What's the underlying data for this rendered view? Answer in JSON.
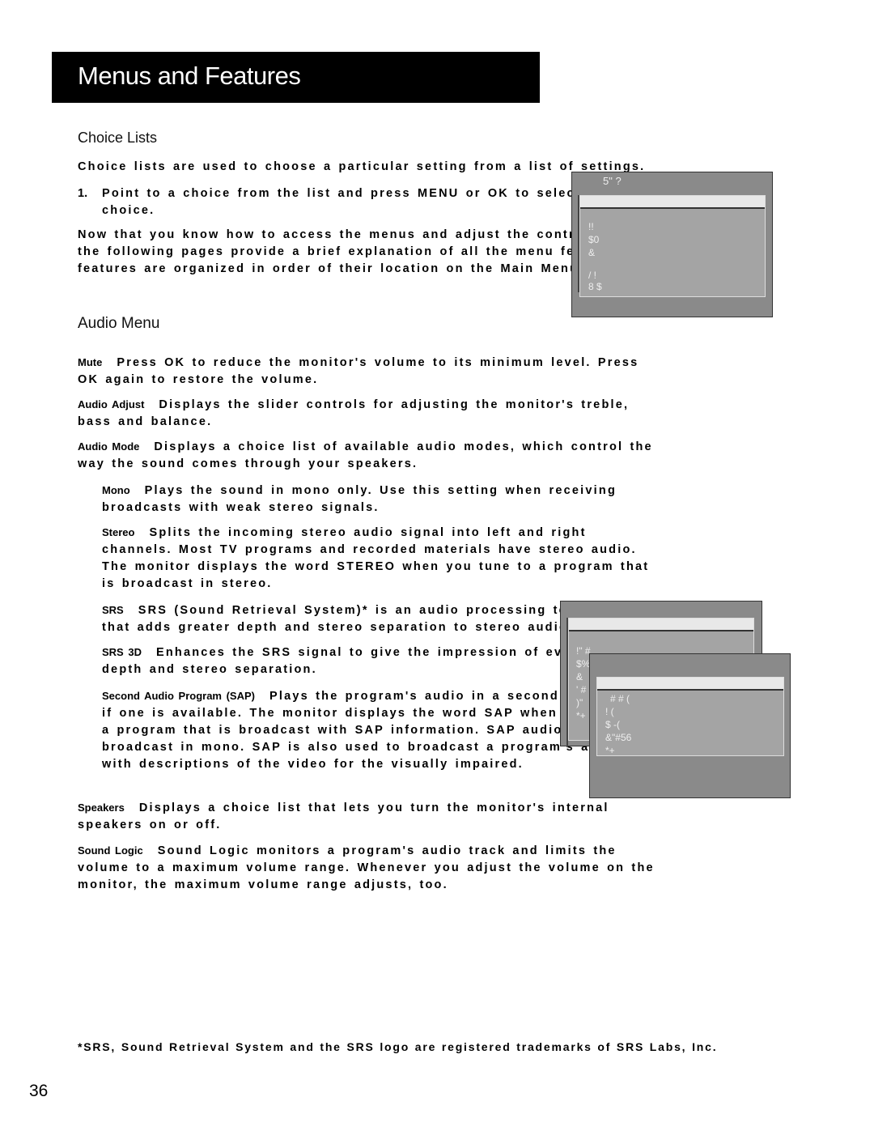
{
  "header": {
    "title": "Menus and Features"
  },
  "choice_lists": {
    "heading": "Choice Lists",
    "intro": "Choice lists are used to choose a particular setting from a list of settings.",
    "step_number": "1.",
    "step_text": "Point to a choice from the list and press MENU or OK to select that choice.",
    "outro": "Now that you know how to access the menus and adjust the control panels the following pages provide a brief explanation of all the menu features. The features are organized in order of their location on the Main Menu."
  },
  "audio_menu": {
    "heading": "Audio Menu",
    "items": [
      {
        "term": "Mute",
        "text": "Press OK to reduce the monitor's volume to its minimum level. Press OK again to restore the volume."
      },
      {
        "term": "Audio Adjust",
        "text": "Displays the slider controls for adjusting the monitor's treble, bass and balance."
      },
      {
        "term": "Audio Mode",
        "text": "Displays a choice list of available audio modes, which control the way the sound comes through your speakers."
      }
    ],
    "sub_items": [
      {
        "term": "Mono",
        "text": "Plays the sound in mono only. Use this setting when receiving broadcasts with weak stereo signals."
      },
      {
        "term": "Stereo",
        "text": "Splits the incoming stereo audio signal into left and right channels. Most TV programs and recorded materials have stereo audio. The monitor displays the word STEREO when you tune to a program that is broadcast in stereo."
      },
      {
        "term": "SRS",
        "text": "SRS (Sound Retrieval System)* is an audio processing technology that adds greater depth and stereo separation to stereo audio signals."
      },
      {
        "term": "SRS 3D",
        "text": "Enhances the SRS signal to give the impression of even greater depth and stereo separation."
      },
      {
        "term": "Second Audio Program (SAP)",
        "text": "Plays the program's audio in a second language, if one is available. The monitor displays the word SAP when you tune to a program that is broadcast with SAP information. SAP audio is broadcast in mono. SAP is also used to broadcast a program's audio with descriptions of the video for the visually impaired."
      }
    ],
    "tail_items": [
      {
        "term": "Speakers",
        "text": "Displays a choice list that lets you turn the monitor's internal speakers on or off."
      },
      {
        "term": "Sound Logic",
        "text": "Sound Logic monitors a program's audio track and limits the volume to a maximum volume range. Whenever you adjust the volume on the monitor, the maximum volume range adjusts, too."
      }
    ]
  },
  "tv_screens": {
    "main_menu": {
      "title": "5\" ?",
      "items": [
        "!!",
        "$0",
        "&",
        "/ !",
        "8 $"
      ]
    },
    "audio_menu": {
      "items": [
        "!\" #",
        "$%",
        "&",
        "' #",
        ")\"",
        "*+"
      ]
    },
    "audio_mode": {
      "items": [
        "# # (",
        "! (",
        "$ -(",
        "&\"#56",
        "*+"
      ]
    }
  },
  "footnote": "*SRS, Sound Retrieval System and the SRS logo are registered trademarks of SRS Labs, Inc.",
  "page_number": "36"
}
